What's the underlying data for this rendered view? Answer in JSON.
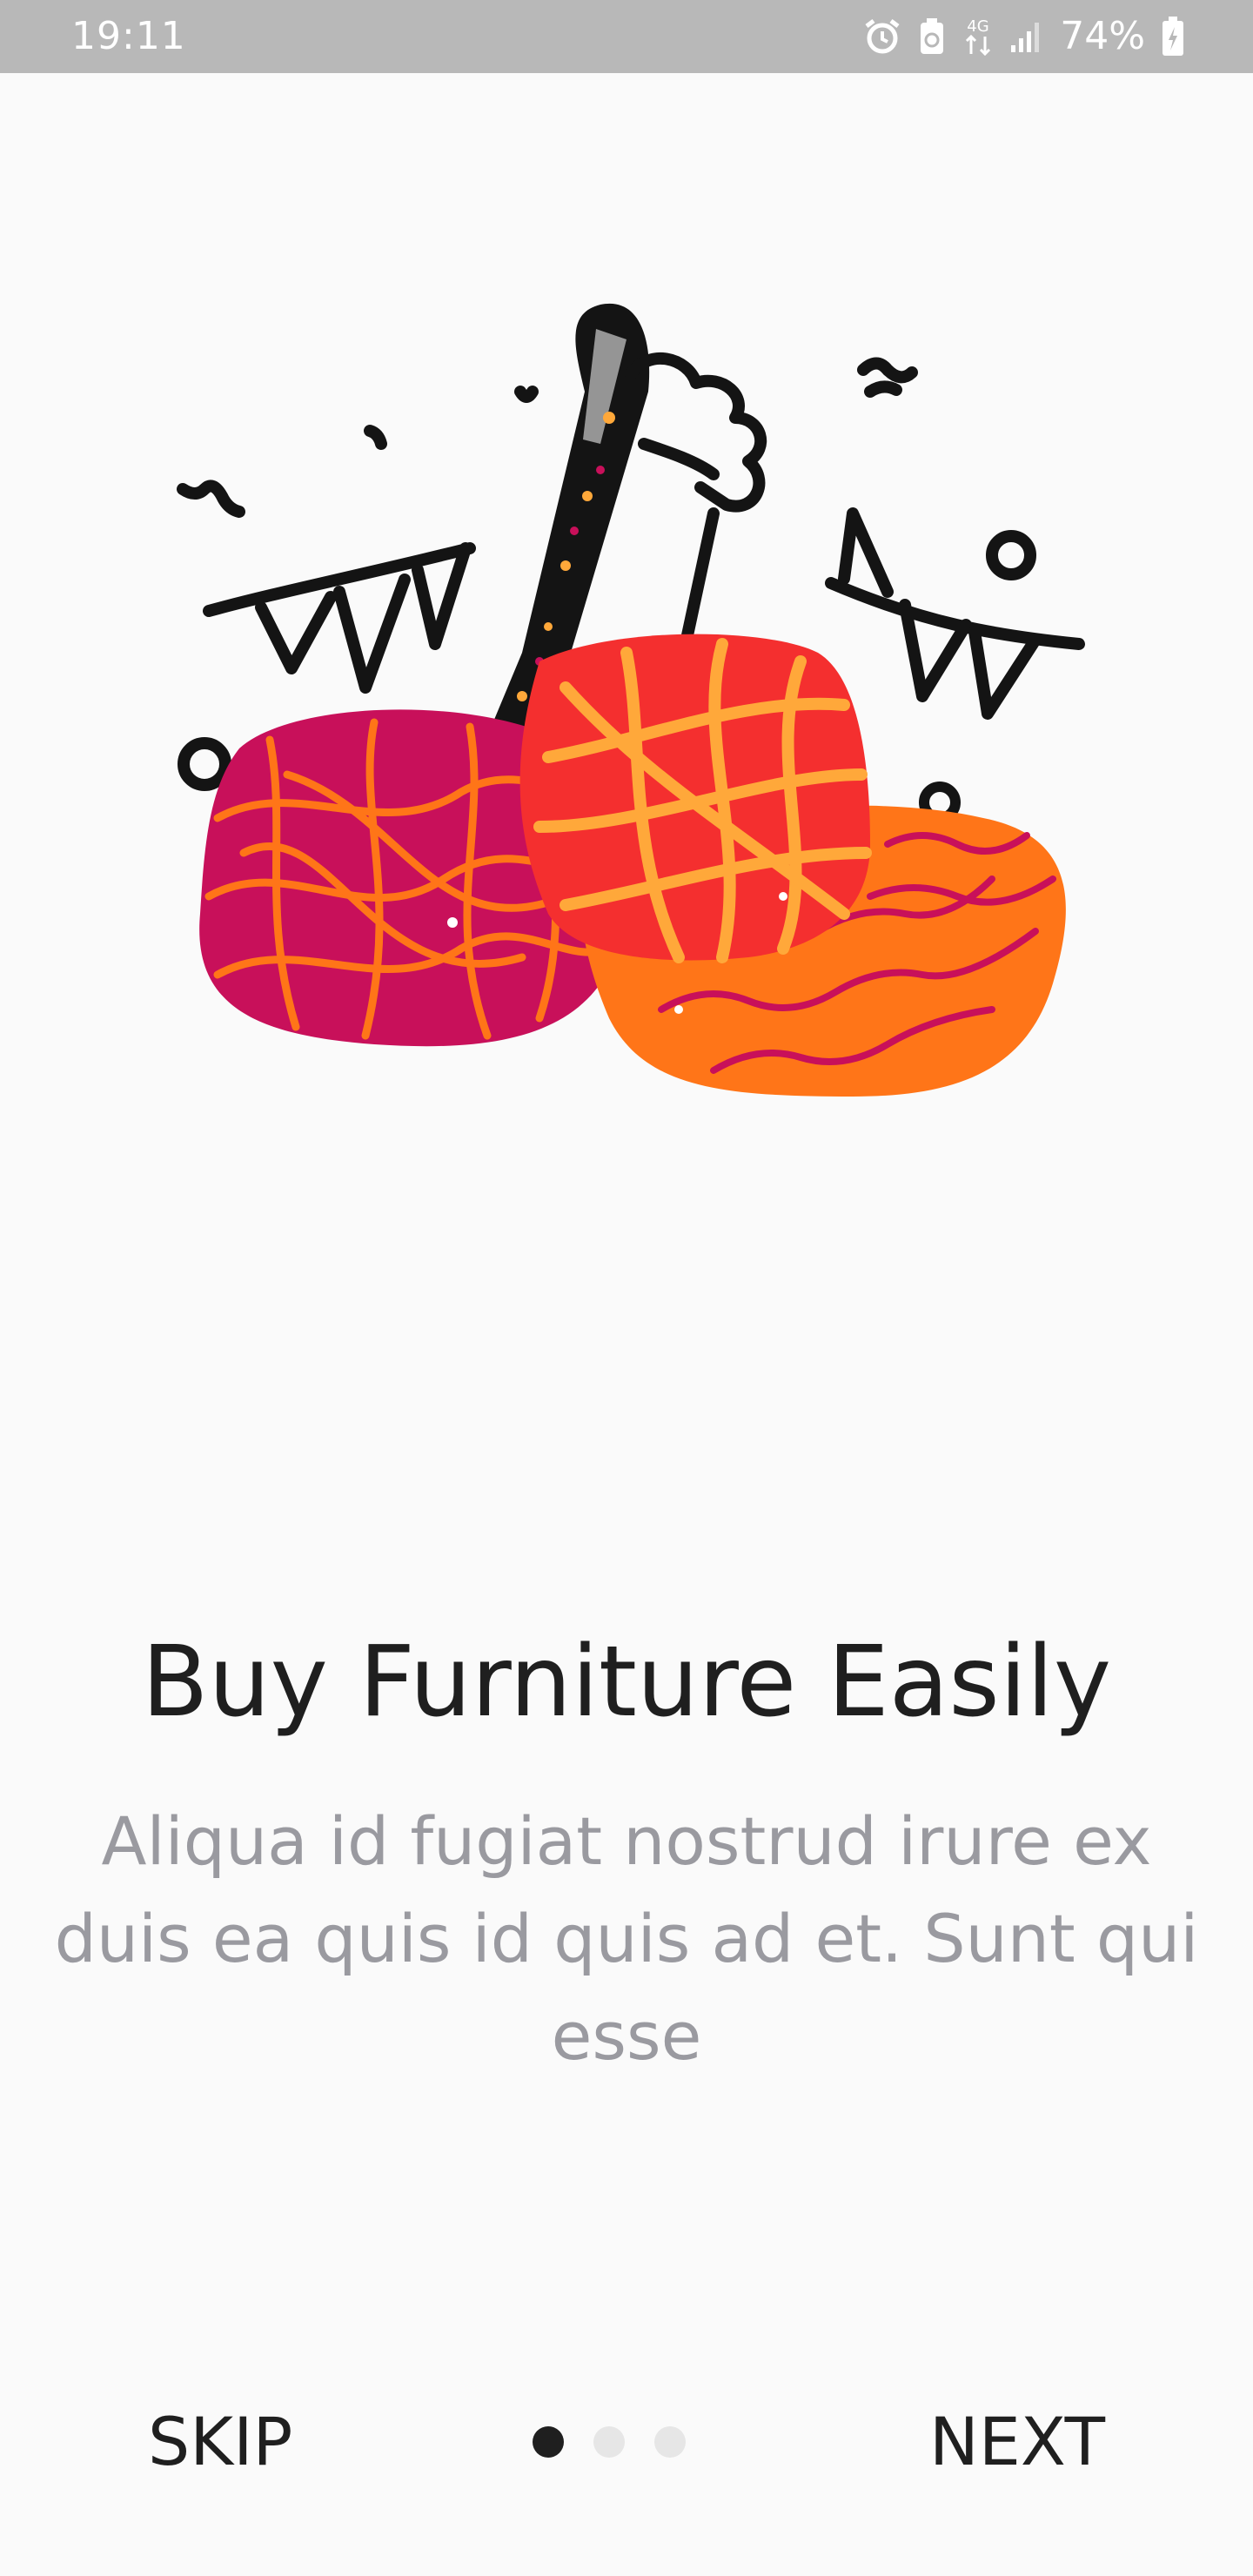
{
  "status_bar": {
    "time": "19:11",
    "network": "4G",
    "battery": "74%",
    "icons": [
      "alarm-icon",
      "battery-saver-icon",
      "4g-data-icon",
      "signal-icon",
      "battery-charging-icon"
    ]
  },
  "onboarding": {
    "illustration": "furniture-party-illustration",
    "title": "Buy Furniture Easily",
    "description": "Aliqua id fugiat nostrud irure ex duis ea quis id quis ad et. Sunt qui esse",
    "page_count": 3,
    "active_page": 1
  },
  "navigation": {
    "skip_label": "SKIP",
    "next_label": "NEXT"
  },
  "colors": {
    "background": "#fafafa",
    "status_bar": "#b8b8b8",
    "title": "#1f1f1f",
    "description": "#9a9aa0",
    "indicator_active": "#1f1f1f",
    "indicator_inactive": "#e6e6e6",
    "magenta": "#c8105a",
    "red": "#f42f2f",
    "orange": "#ff7518",
    "yellow_orange": "#ffa83a"
  }
}
